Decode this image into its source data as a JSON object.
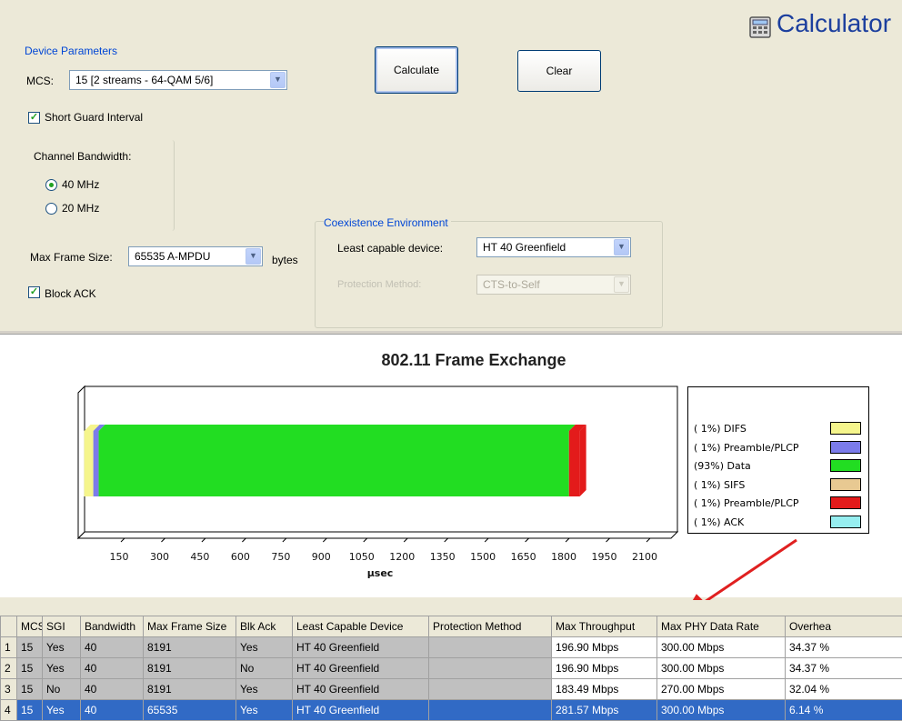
{
  "app": {
    "title": "Calculator"
  },
  "device_params": {
    "title": "Device Parameters",
    "mcs_label": "MCS:",
    "mcs_value": "15 [2 streams - 64-QAM 5/6]",
    "short_guard_interval_label": "Short Guard Interval",
    "short_guard_interval_checked": true,
    "channel_bandwidth_label": "Channel Bandwidth:",
    "bw_40_label": "40 MHz",
    "bw_20_label": "20 MHz",
    "bw_selected": "40 MHz",
    "max_frame_label": "Max Frame Size:",
    "max_frame_value": "65535 A-MPDU",
    "max_frame_unit": "bytes",
    "block_ack_label": "Block ACK",
    "block_ack_checked": true
  },
  "buttons": {
    "calculate": "Calculate",
    "clear": "Clear"
  },
  "coexistence": {
    "title": "Coexistence Environment",
    "least_capable_label": "Least capable device:",
    "least_capable_value": "HT 40 Greenfield",
    "protection_label": "Protection Method:",
    "protection_value": "CTS-to-Self"
  },
  "chart_data": {
    "type": "bar",
    "title": "802.11 Frame Exchange",
    "xlabel": "µsec",
    "orientation": "horizontal-stacked",
    "x_ticks": [
      150,
      300,
      450,
      600,
      750,
      900,
      1050,
      1200,
      1350,
      1500,
      1650,
      1800,
      1950,
      2100
    ],
    "xlim": [
      0,
      2200
    ],
    "segments": [
      {
        "name": "( 1%) DIFS",
        "value": 34,
        "color": "#f5f58c"
      },
      {
        "name": "( 1%) Preamble/PLCP",
        "value": 20,
        "color": "#7b7bea"
      },
      {
        "name": "(93%) Data",
        "value": 1745,
        "color": "#22dd22"
      },
      {
        "name": "( 1%) SIFS",
        "value": 0,
        "color": "#e8c992"
      },
      {
        "name": "( 1%) Preamble/PLCP",
        "value": 40,
        "color": "#e31b1b"
      },
      {
        "name": "( 1%) ACK",
        "value": 0,
        "color": "#96eef0"
      }
    ]
  },
  "grid": {
    "columns": [
      "",
      "MCS",
      "SGI",
      "Bandwidth",
      "Max Frame Size",
      "Blk Ack",
      "Least Capable Device",
      "Protection Method",
      "Max Throughput",
      "Max PHY Data Rate",
      "Overhea"
    ],
    "rows": [
      [
        "1",
        "15",
        "Yes",
        "40",
        "8191",
        "Yes",
        "HT 40 Greenfield",
        "",
        "196.90 Mbps",
        "300.00 Mbps",
        "34.37 %"
      ],
      [
        "2",
        "15",
        "Yes",
        "40",
        "8191",
        "No",
        "HT 40 Greenfield",
        "",
        "196.90 Mbps",
        "300.00 Mbps",
        "34.37 %"
      ],
      [
        "3",
        "15",
        "No",
        "40",
        "8191",
        "Yes",
        "HT 40 Greenfield",
        "",
        "183.49 Mbps",
        "270.00 Mbps",
        "32.04 %"
      ],
      [
        "4",
        "15",
        "Yes",
        "40",
        "65535",
        "Yes",
        "HT 40 Greenfield",
        "",
        "281.57 Mbps",
        "300.00 Mbps",
        "6.14 %"
      ]
    ],
    "selected_row": 3
  },
  "colors": {
    "annotation_arrow": "#e02020",
    "selection": "#316ac5",
    "group_title": "#0046d5"
  }
}
